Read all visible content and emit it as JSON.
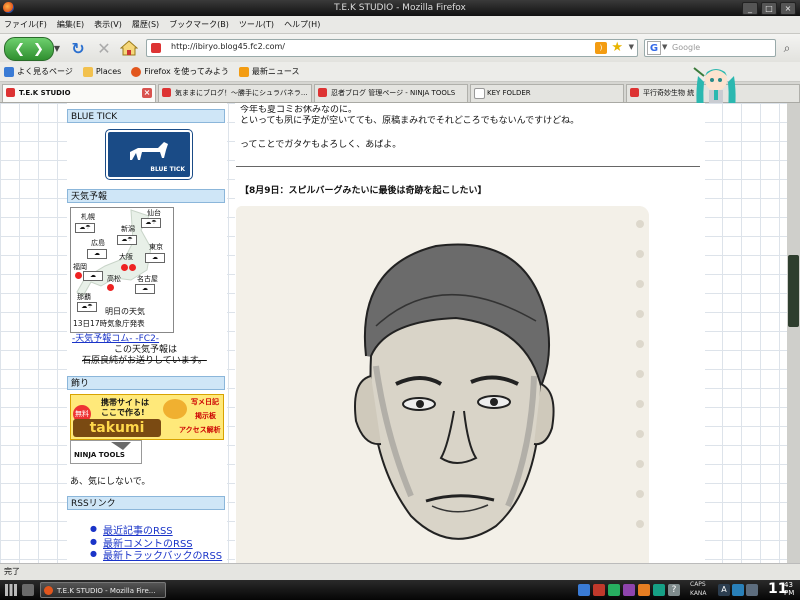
{
  "window": {
    "title": "T.E.K STUDIO - Mozilla Firefox"
  },
  "menu": [
    "ファイル(F)",
    "編集(E)",
    "表示(V)",
    "履歴(S)",
    "ブックマーク(B)",
    "ツール(T)",
    "ヘルプ(H)"
  ],
  "nav": {
    "url": "http://ibiryo.blog45.fc2.com/",
    "search_placeholder": "Google",
    "search_engine": "G"
  },
  "bookmarks": [
    "よく見るページ",
    "Places",
    "Firefox を使ってみよう",
    "最新ニュース"
  ],
  "tabs": [
    {
      "label": "T.E.K STUDIO",
      "active": true
    },
    {
      "label": "気ままにブログ！～勝手にシュラバネラ...",
      "active": false
    },
    {
      "label": "忍者ブログ 管理ページ - NINJA TOOLS",
      "active": false
    },
    {
      "label": "KEY FOLDER",
      "active": false
    },
    {
      "label": "平行奇妙生物 統",
      "active": false
    }
  ],
  "sidebar": {
    "bluetick_title": "BLUE TICK",
    "bluetick_logo": "BLUE TICK",
    "weather_title": "天気予報",
    "weather": {
      "cities": [
        "札幌",
        "仙台",
        "新潟",
        "広島",
        "東京",
        "大阪",
        "福岡",
        "高松",
        "名古屋",
        "那覇"
      ],
      "caption1": "明日の天気",
      "caption2": "13日17時気象庁発表",
      "link": "-天気予報コム- -FC2-",
      "note1": "この天気予報は",
      "note2": "石原良純がお送りしています。"
    },
    "misc_title": "飾り",
    "ad": {
      "badge": "無料",
      "line1": "携帯サイトは",
      "line2": "ここで作る!",
      "brand": "takumi",
      "right1": "写メ日記",
      "right2": "掲示板",
      "right3": "アクセス解析"
    },
    "ninja": "NINJA TOOLS",
    "misc_note": "あ、気にしないで。",
    "rss_title": "RSSリンク",
    "rss_links": [
      "最近記事のRSS",
      "最新コメントのRSS",
      "最新トラックバックのRSS"
    ]
  },
  "content": {
    "line1": "今年も夏コミお休みなのに。",
    "line2": "といっても夙に予定が空いてても、原稿まみれでそれどころでもないんですけどね。",
    "line3": "ってことでガタケもよろしく、あばよ。",
    "post_title": "【8月9日：スピルバーグみたいに最後は奇跡を起こしたい】"
  },
  "status": {
    "text": "完了"
  },
  "taskbar": {
    "item": "T.E.K STUDIO - Mozilla Fire...",
    "clock_hour": "11",
    "clock_min_top": "43",
    "clock_min_bot": "PM",
    "caps": "CAPS",
    "kana": "KANA"
  }
}
